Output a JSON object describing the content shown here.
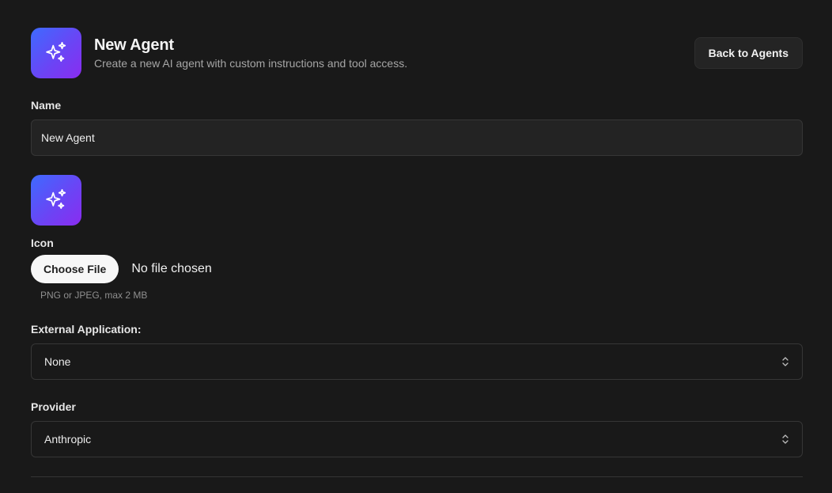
{
  "header": {
    "title": "New Agent",
    "subtitle": "Create a new AI agent with custom instructions and tool access.",
    "back_label": "Back to Agents",
    "logo_icon": "sparkles-icon"
  },
  "form": {
    "name": {
      "label": "Name",
      "value": "New Agent"
    },
    "icon": {
      "label": "Icon",
      "choose_label": "Choose File",
      "file_status": "No file chosen",
      "hint": "PNG or JPEG, max 2 MB"
    },
    "external_app": {
      "label": "External Application:",
      "value": "None"
    },
    "provider": {
      "label": "Provider",
      "value": "Anthropic"
    }
  },
  "colors": {
    "background": "#191919",
    "gradient_start": "#3d6bff",
    "gradient_end": "#8a2cf0"
  }
}
